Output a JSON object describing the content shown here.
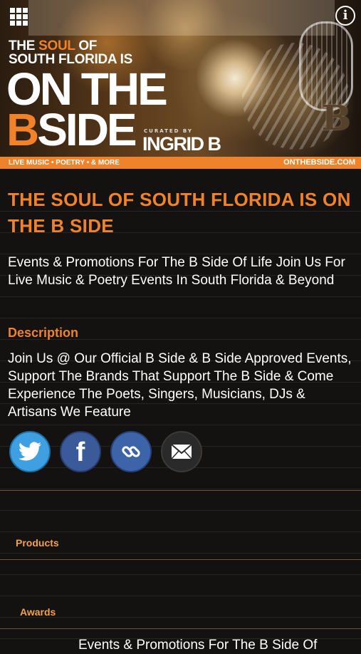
{
  "header": {
    "headline_small_part1": "THE ",
    "headline_small_orange": "SOUL",
    "headline_small_part2": " OF",
    "headline_small_line2": "SOUTH FLORIDA IS",
    "headline_big_line1": "ON THE",
    "headline_big_b": "B",
    "headline_big_rest": "SIDE",
    "curated_label": "CURATED BY",
    "curator_name": "INGRID B",
    "b_logo": "B",
    "strip_left": "LIVE MUSIC • POETRY • & MORE",
    "strip_right": "ONTHEBSIDE.COM"
  },
  "main": {
    "title": "THE SOUL OF SOUTH FLORIDA IS ON THE B SIDE",
    "subtitle": "Events & Promotions For The B Side Of Life Join Us For Live Music & Poetry Events In South Florida & Beyond",
    "description_heading": "Description",
    "description_body": "Join Us @ Our Official B Side & B Side Approved Events, Support The Brands That Support The B Side & Come Experience The Poets, Singers, Musicians, DJs & Artisans We Feature"
  },
  "sections": {
    "products_label": "Products",
    "awards_label": "Awards"
  },
  "footer": {
    "partial_text": "Events & Promotions For The B Side Of"
  },
  "colors": {
    "accent": "#f0832a",
    "background": "#141210"
  },
  "icons": [
    "menu-grid-icon",
    "info-icon",
    "twitter-icon",
    "facebook-icon",
    "link-icon",
    "email-icon"
  ]
}
